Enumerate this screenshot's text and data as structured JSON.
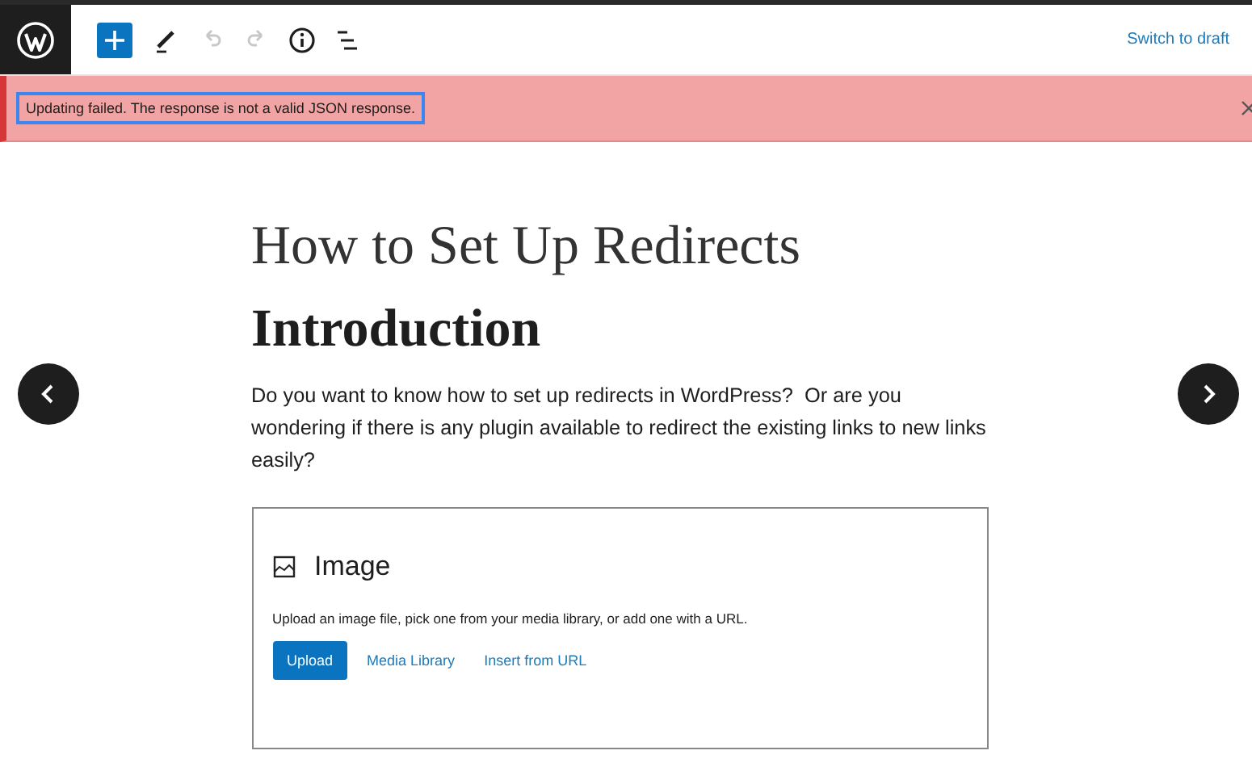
{
  "toolbar": {
    "tools": [
      {
        "kind": "add",
        "disabled": false
      },
      {
        "kind": "edit",
        "disabled": false
      },
      {
        "kind": "undo",
        "disabled": true
      },
      {
        "kind": "redo",
        "disabled": true
      },
      {
        "kind": "info",
        "disabled": false
      },
      {
        "kind": "outline",
        "disabled": false
      }
    ],
    "switch_link": "Switch to draft"
  },
  "notice": {
    "text": "Updating failed. The response is not a valid JSON response.",
    "highlighted": true
  },
  "post": {
    "title": "How to Set Up Redirects",
    "heading": "Introduction",
    "paragraph": "Do you want to know how to set up redirects in WordPress?  Or are you wondering if there is any plugin available to redirect the existing links to new links easily?",
    "image_block": {
      "label": "Image",
      "instructions": "Upload an image file, pick one from your media library, or add one with a URL.",
      "actions": [
        {
          "kind": "primary",
          "label": "Upload"
        },
        {
          "kind": "link",
          "label": "Media Library"
        },
        {
          "kind": "link",
          "label": "Insert from URL"
        }
      ]
    }
  }
}
